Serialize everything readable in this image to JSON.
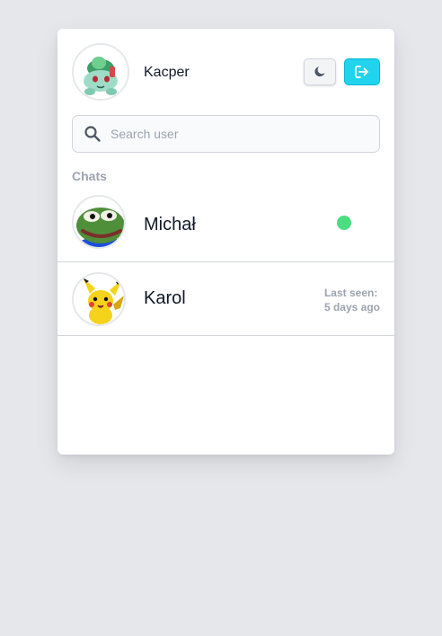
{
  "user": {
    "name": "Kacper",
    "avatar_icon": "bulbasaur-avatar"
  },
  "header": {
    "theme_toggle_icon": "moon-icon",
    "logout_icon": "logout-icon",
    "accent_color": "#22d3ee"
  },
  "search": {
    "placeholder": "Search user",
    "value": ""
  },
  "chats_label": "Chats",
  "chats": [
    {
      "name": "Michał",
      "avatar_icon": "pepe-frog-avatar",
      "status": "online",
      "status_color": "#4ade80"
    },
    {
      "name": "Karol",
      "avatar_icon": "pikachu-avatar",
      "status": "offline",
      "last_seen_label": "Last seen:",
      "last_seen_value": "5 days ago"
    }
  ]
}
